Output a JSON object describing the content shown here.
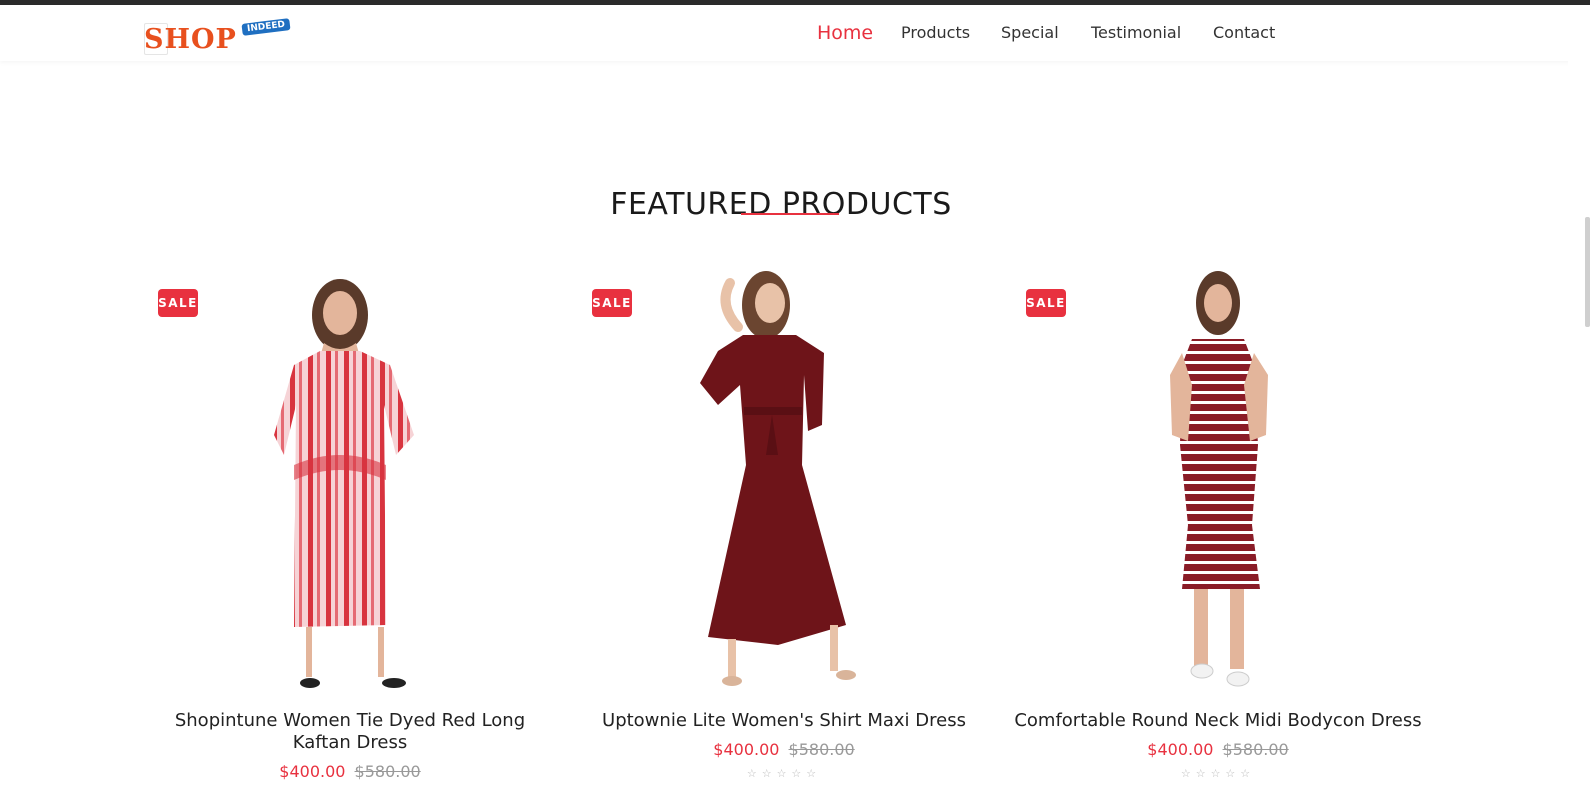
{
  "brand": {
    "logo_text": "SHOP",
    "logo_badge": "INDEED"
  },
  "nav": {
    "home": "Home",
    "products": "Products",
    "special": "Special",
    "testimonial": "Testimonial",
    "contact": "Contact"
  },
  "featured": {
    "title": "FEATURED PRODUCTS",
    "products": [
      {
        "badge": "SALE",
        "name": "Shopintune Women Tie Dyed Red Long Kaftan Dress",
        "price": "$400.00",
        "old_price": "$580.00",
        "stars": "☆☆☆☆☆"
      },
      {
        "badge": "SALE",
        "name": "Uptownie Lite Women's Shirt Maxi Dress",
        "price": "$400.00",
        "old_price": "$580.00",
        "stars": "☆☆☆☆☆"
      },
      {
        "badge": "SALE",
        "name": "Comfortable Round Neck Midi Bodycon Dress",
        "price": "$400.00",
        "old_price": "$580.00",
        "stars": "☆☆☆☆☆"
      }
    ]
  },
  "colors": {
    "accent": "#e8313f",
    "kaftan_red": "#d8343f",
    "maroon": "#6e1419",
    "stripe": "#8a1c27"
  }
}
